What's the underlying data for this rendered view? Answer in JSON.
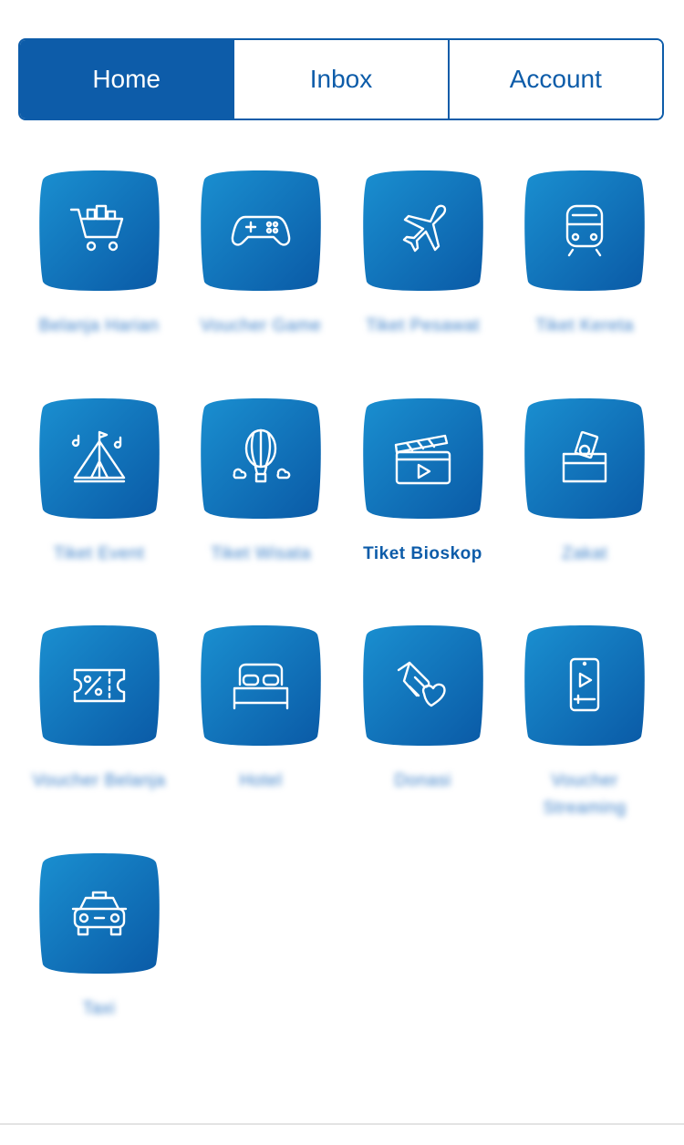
{
  "tabs": [
    {
      "label": "Home",
      "active": true
    },
    {
      "label": "Inbox",
      "active": false
    },
    {
      "label": "Account",
      "active": false
    }
  ],
  "colors": {
    "primary": "#0d5ca9",
    "tile_light": "#1a8fd0",
    "tile_dark": "#0a5aa6",
    "white": "#ffffff"
  },
  "menu": [
    {
      "label": "Belanja Harian",
      "icon": "shopping-cart-icon",
      "blurred": true
    },
    {
      "label": "Voucher Game",
      "icon": "gamepad-icon",
      "blurred": true
    },
    {
      "label": "Tiket Pesawat",
      "icon": "airplane-icon",
      "blurred": true
    },
    {
      "label": "Tiket Kereta",
      "icon": "train-icon",
      "blurred": true
    },
    {
      "label": "Tiket Event",
      "icon": "tent-icon",
      "blurred": true
    },
    {
      "label": "Tiket Wisata",
      "icon": "hot-air-balloon-icon",
      "blurred": true
    },
    {
      "label": "Tiket Bioskop",
      "icon": "clapperboard-icon",
      "blurred": false
    },
    {
      "label": "Zakat",
      "icon": "donation-box-icon",
      "blurred": true
    },
    {
      "label": "Voucher Belanja",
      "icon": "voucher-icon",
      "blurred": true
    },
    {
      "label": "Hotel",
      "icon": "bed-icon",
      "blurred": true
    },
    {
      "label": "Donasi",
      "icon": "helping-hand-icon",
      "blurred": true
    },
    {
      "label": "Voucher Streaming",
      "icon": "phone-play-icon",
      "blurred": true
    },
    {
      "label": "Taxi",
      "icon": "taxi-icon",
      "blurred": true
    }
  ]
}
